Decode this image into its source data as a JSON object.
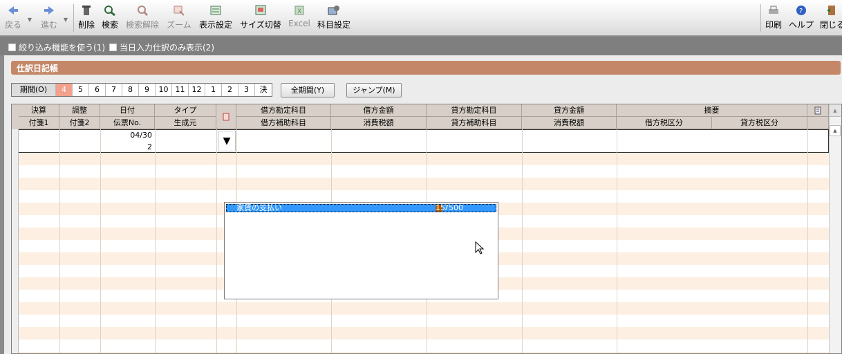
{
  "toolbar": {
    "back": "戻る",
    "forward": "進む",
    "delete": "削除",
    "search": "検索",
    "search_clear": "検索解除",
    "zoom": "ズーム",
    "display_settings": "表示設定",
    "size_toggle": "サイズ切替",
    "excel": "Excel",
    "account_settings": "科目設定",
    "print": "印刷",
    "help": "ヘルプ",
    "close": "閉じる"
  },
  "filters": {
    "use_filter": "絞り込み機能を使う(1)",
    "today_only": "当日入力仕訳のみ表示(2)"
  },
  "section_title": "仕訳日記帳",
  "period": {
    "label": "期間(O)",
    "months": [
      "4",
      "5",
      "6",
      "7",
      "8",
      "9",
      "10",
      "11",
      "12",
      "1",
      "2",
      "3",
      "決"
    ],
    "selected": "4",
    "all_period_button": "全期間(Y)",
    "jump_button": "ジャンプ(M)"
  },
  "grid": {
    "headers_top": [
      "決算",
      "調整",
      "日付",
      "タイプ",
      "",
      "借方勘定科目",
      "借方金額",
      "貸方勘定科目",
      "貸方金額",
      "摘要"
    ],
    "headers_bottom": [
      "付箋1",
      "付箋2",
      "伝票No.",
      "生成元",
      "",
      "借方補助科目",
      "消費税額",
      "貸方補助科目",
      "消費税額",
      "借方税区分",
      "貸方税区分"
    ],
    "current_row": {
      "date": "04/30",
      "voucher_no": "2"
    }
  },
  "dropdown": {
    "selected_item": "家賃の支払い",
    "selected_code_highlight": "15",
    "selected_code_rest": "7500"
  },
  "colors": {
    "accent": "#c48868",
    "selected_month": "#f3a08d",
    "list_highlight": "#3399ff"
  }
}
